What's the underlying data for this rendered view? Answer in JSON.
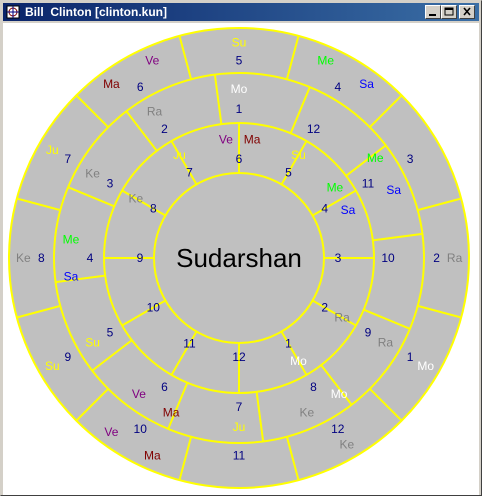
{
  "window": {
    "title": "Bill  Clinton [clinton.kun]"
  },
  "colors": {
    "ring_line": "#ffff00",
    "wedge_fill": "#c0c0c0",
    "number": "#000080",
    "center_text": "#000000",
    "planets": {
      "Su": "#ffff00",
      "Mo": "#ffffff",
      "Ma": "#800000",
      "Me": "#00ff00",
      "Ju": "#ffff00",
      "Ve": "#800080",
      "Sa": "#0000ff",
      "Ra": "#808080",
      "Ke": "#808080"
    }
  },
  "chart": {
    "center_label": "Sudarshan",
    "outer_ring": [
      {
        "house": "5",
        "planets": [
          "Su"
        ]
      },
      {
        "house": "4",
        "planets": [
          "Me",
          "Sa"
        ]
      },
      {
        "house": "3",
        "planets": []
      },
      {
        "house": "2",
        "planets": [
          "Ra"
        ]
      },
      {
        "house": "1",
        "planets": [
          "Mo"
        ]
      },
      {
        "house": "12",
        "planets": [
          "Ke"
        ]
      },
      {
        "house": "11",
        "planets": []
      },
      {
        "house": "10",
        "planets": [
          "Ma",
          "Ve"
        ]
      },
      {
        "house": "9",
        "planets": [
          "Su"
        ]
      },
      {
        "house": "8",
        "planets": [
          "Ke"
        ]
      },
      {
        "house": "7",
        "planets": [
          "Ju"
        ]
      },
      {
        "house": "6",
        "planets": [
          "Ma",
          "Ve"
        ]
      }
    ],
    "middle_ring": [
      {
        "house": "1",
        "planets": [
          "Mo"
        ]
      },
      {
        "house": "12",
        "planets": []
      },
      {
        "house": "11",
        "planets": [
          "Me",
          "Sa"
        ]
      },
      {
        "house": "10",
        "planets": []
      },
      {
        "house": "9",
        "planets": [
          "Ra"
        ]
      },
      {
        "house": "8",
        "planets": [
          "Mo",
          "Ke"
        ]
      },
      {
        "house": "7",
        "planets": [
          "Ju"
        ]
      },
      {
        "house": "6",
        "planets": [
          "Ma",
          "Ve"
        ]
      },
      {
        "house": "5",
        "planets": [
          "Su"
        ]
      },
      {
        "house": "4",
        "planets": [
          "Sa",
          "Me"
        ]
      },
      {
        "house": "3",
        "planets": [
          "Ke"
        ]
      },
      {
        "house": "2",
        "planets": [
          "Ra"
        ]
      }
    ],
    "inner_ring": [
      {
        "house": "6",
        "planets": [
          "Ve",
          "Ma"
        ]
      },
      {
        "house": "5",
        "planets": [
          "Su"
        ]
      },
      {
        "house": "4",
        "planets": [
          "Me",
          "Sa"
        ]
      },
      {
        "house": "3",
        "planets": []
      },
      {
        "house": "2",
        "planets": [
          "Ra"
        ]
      },
      {
        "house": "1",
        "planets": [
          "Mo"
        ]
      },
      {
        "house": "12",
        "planets": []
      },
      {
        "house": "11",
        "planets": []
      },
      {
        "house": "10",
        "planets": []
      },
      {
        "house": "9",
        "planets": []
      },
      {
        "house": "8",
        "planets": [
          "Ke"
        ]
      },
      {
        "house": "7",
        "planets": [
          "Ju"
        ]
      }
    ]
  }
}
